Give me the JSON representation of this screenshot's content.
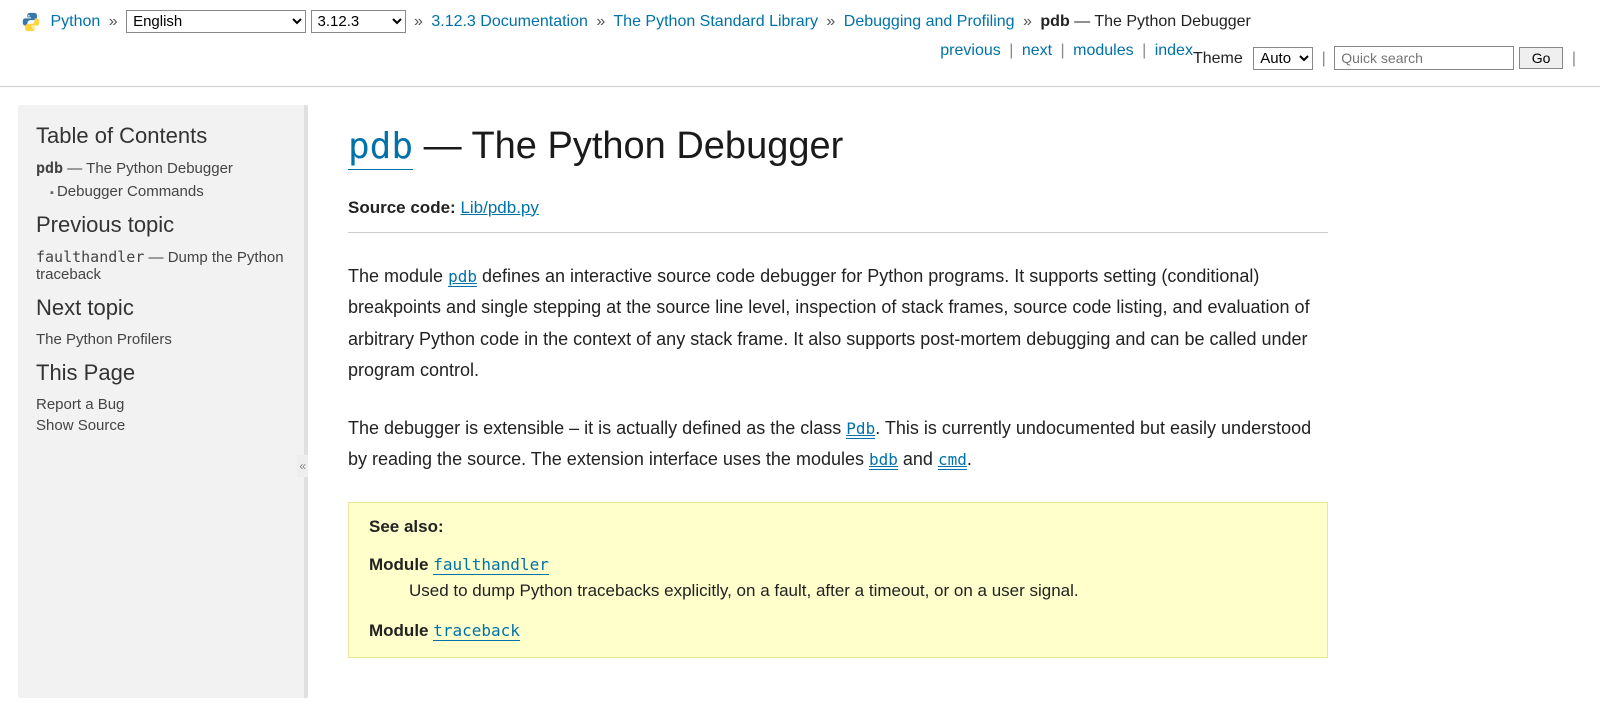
{
  "nav": {
    "python_label": "Python",
    "lang_selected": "English",
    "ver_selected": "3.12.3",
    "breadcrumbs": {
      "doc": "3.12.3 Documentation",
      "lib": "The Python Standard Library",
      "debug": "Debugging and Profiling",
      "current_mod": "pdb",
      "current_suffix": " — The Python Debugger"
    },
    "right": {
      "previous": "previous",
      "next": "next",
      "modules": "modules",
      "index": "index"
    },
    "theme_label": "Theme",
    "theme_selected": "Auto",
    "search_placeholder": "Quick search",
    "go_label": "Go"
  },
  "sidebar": {
    "toc_heading": "Table of Contents",
    "toc_root_mod": "pdb",
    "toc_root_suffix": " — The Python Debugger",
    "toc_sub1": "Debugger Commands",
    "prev_heading": "Previous topic",
    "prev_mod": "faulthandler",
    "prev_suffix": " — Dump the Python traceback",
    "next_heading": "Next topic",
    "next_text": "The Python Profilers",
    "thispage_heading": "This Page",
    "report_bug": "Report a Bug",
    "show_source": "Show Source",
    "collapse": "«"
  },
  "main": {
    "title_mod": "pdb",
    "title_suffix": " — The Python Debugger",
    "source_label": "Source code:",
    "source_link": "Lib/pdb.py",
    "para1_pre": "The module ",
    "para1_mod": "pdb",
    "para1_post": " defines an interactive source code debugger for Python programs. It supports setting (conditional) breakpoints and single stepping at the source line level, inspection of stack frames, source code listing, and evaluation of arbitrary Python code in the context of any stack frame. It also supports post-mortem debugging and can be called under program control.",
    "para2_pre": "The debugger is extensible – it is actually defined as the class ",
    "para2_cls": "Pdb",
    "para2_mid": ". This is currently undocumented but easily understood by reading the source. The extension interface uses the modules ",
    "para2_mod1": "bdb",
    "para2_and": " and ",
    "para2_mod2": "cmd",
    "para2_end": "."
  },
  "seealso": {
    "title": "See also:",
    "module_label": "Module",
    "items": [
      {
        "name": "faulthandler",
        "desc": "Used to dump Python tracebacks explicitly, on a fault, after a timeout, or on a user signal."
      },
      {
        "name": "traceback",
        "desc": ""
      }
    ]
  }
}
